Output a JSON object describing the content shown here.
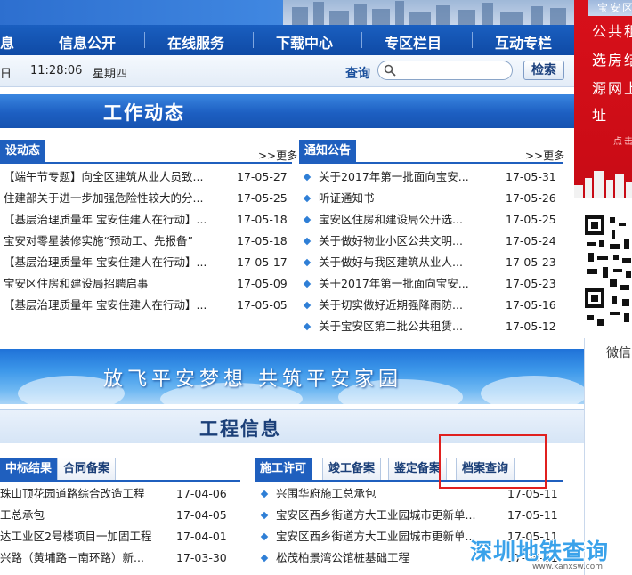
{
  "banner_right_text": "宝安区",
  "nav": {
    "items": [
      "息",
      "信息公开",
      "在线服务",
      "下载中心",
      "专区栏目",
      "互动专栏"
    ]
  },
  "infobar": {
    "date": "日",
    "time": "11:28:06",
    "weekday": "星期四",
    "search_label": "查询",
    "search_placeholder": "",
    "search_button": "检索"
  },
  "work_news": {
    "title": "工作动态",
    "left": {
      "tab": "设动态",
      "more": ">>更多",
      "items": [
        {
          "text": "【端午节专题】向全区建筑从业人员致...",
          "date": "17-05-27"
        },
        {
          "text": "住建部关于进一步加强危险性较大的分...",
          "date": "17-05-25"
        },
        {
          "text": "【基层治理质量年 宝安住建人在行动】...",
          "date": "17-05-18"
        },
        {
          "text": "宝安对零星装修实施“预动工、先报备”",
          "date": "17-05-18"
        },
        {
          "text": "【基层治理质量年 宝安住建人在行动】...",
          "date": "17-05-17"
        },
        {
          "text": "宝安区住房和建设局招聘启事",
          "date": "17-05-09"
        },
        {
          "text": "【基层治理质量年 宝安住建人在行动】...",
          "date": "17-05-05"
        }
      ]
    },
    "right": {
      "tab": "通知公告",
      "more": ">>更多",
      "items": [
        {
          "text": "关于2017年第一批面向宝安...",
          "date": "17-05-31"
        },
        {
          "text": "听证通知书",
          "date": "17-05-26"
        },
        {
          "text": "宝安区住房和建设局公开选...",
          "date": "17-05-25"
        },
        {
          "text": "关于做好物业小区公共文明...",
          "date": "17-05-24"
        },
        {
          "text": "关于做好与我区建筑从业人...",
          "date": "17-05-23"
        },
        {
          "text": "关于2017年第一批面向宝安...",
          "date": "17-05-23"
        },
        {
          "text": "关于切实做好近期强降雨防...",
          "date": "17-05-16"
        },
        {
          "text": "关于宝安区第二批公共租赁...",
          "date": "17-05-12"
        }
      ]
    }
  },
  "slogan": "放飞平安梦想 共筑平安家园",
  "project_info": {
    "title": "工程信息",
    "left_tabs": [
      "中标结果",
      "合同备案"
    ],
    "left_items": [
      {
        "text": "珠山顶花园道路综合改造工程",
        "date": "17-04-06"
      },
      {
        "text": "工总承包",
        "date": "17-04-05"
      },
      {
        "text": "达工业区2号楼项目一加固工程",
        "date": "17-04-01"
      },
      {
        "text": "兴路（黄埔路－南环路）新...",
        "date": "17-03-30"
      }
    ],
    "right_tabs": [
      "施工许可",
      "竣工备案",
      "鉴定备案",
      "档案查询"
    ],
    "right_items": [
      {
        "text": "兴围华府施工总承包",
        "date": "17-05-11"
      },
      {
        "text": "宝安区西乡街道方大工业园城市更新单...",
        "date": "17-05-11"
      },
      {
        "text": "宝安区西乡街道方大工业园城市更新单...",
        "date": "17-05-11"
      },
      {
        "text": "松茂柏景湾公馆桩基础工程",
        "date": "17-05-11"
      }
    ]
  },
  "side": {
    "red_lines": [
      "公共租",
      "选房结",
      "源网上",
      "址"
    ],
    "red_small": "点击",
    "weixin": "微信"
  },
  "watermark": {
    "text": "深圳地铁查询",
    "url": "www.kanxsw.com"
  },
  "colors": {
    "nav_blue": "#0f4aa5",
    "section_blue": "#1d5fc2",
    "side_red": "#c80b15",
    "highlight_red": "#e0201f"
  }
}
